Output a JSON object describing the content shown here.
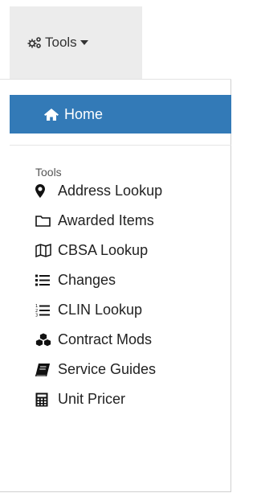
{
  "header": {
    "tools_menu": {
      "label": "Tools",
      "icon": "cogs-icon",
      "caret": "caret-down-icon"
    }
  },
  "nav": {
    "home": {
      "label": "Home",
      "icon": "home-icon",
      "color": "#337ab7"
    }
  },
  "tools_section": {
    "heading": "Tools",
    "items": [
      {
        "label": "Address Lookup",
        "icon": "map-marker-icon"
      },
      {
        "label": "Awarded Items",
        "icon": "folder-icon"
      },
      {
        "label": "CBSA Lookup",
        "icon": "map-icon"
      },
      {
        "label": "Changes",
        "icon": "list-icon"
      },
      {
        "label": "CLIN Lookup",
        "icon": "ordered-list-icon"
      },
      {
        "label": "Contract Mods",
        "icon": "cubes-icon"
      },
      {
        "label": "Service Guides",
        "icon": "book-icon"
      },
      {
        "label": "Unit Pricer",
        "icon": "calculator-icon"
      }
    ]
  }
}
